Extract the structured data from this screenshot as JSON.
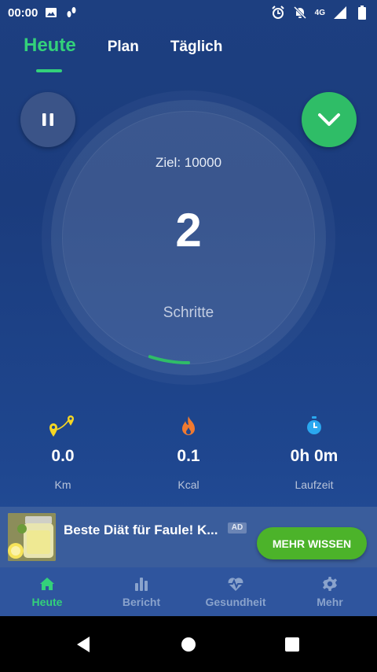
{
  "status_bar": {
    "time": "00:00",
    "network": "4G",
    "icons": [
      "image-icon",
      "footsteps-icon",
      "alarm-icon",
      "notifications-off-icon",
      "signal-icon",
      "battery-icon"
    ]
  },
  "tabs": [
    {
      "label": "Heute",
      "active": true
    },
    {
      "label": "Plan",
      "active": false
    },
    {
      "label": "Täglich",
      "active": false
    }
  ],
  "tracker": {
    "goal_label": "Ziel: 10000",
    "step_count": "2",
    "steps_label": "Schritte",
    "progress_fraction": 0.0002
  },
  "stats": [
    {
      "value": "0.0",
      "unit": "Km",
      "icon": "map-route-icon",
      "color": "#f5d623"
    },
    {
      "value": "0.1",
      "unit": "Kcal",
      "icon": "flame-icon",
      "color": "#f07a30"
    },
    {
      "value": "0h 0m",
      "unit": "Laufzeit",
      "icon": "stopwatch-icon",
      "color": "#2aa8f0"
    }
  ],
  "ad": {
    "title": "Beste Diät für Faule! K...",
    "badge": "AD",
    "cta": "MEHR WISSEN"
  },
  "bottom_nav": [
    {
      "label": "Heute",
      "icon": "home-icon",
      "active": true
    },
    {
      "label": "Bericht",
      "icon": "bar-chart-icon",
      "active": false
    },
    {
      "label": "Gesundheit",
      "icon": "heart-pulse-icon",
      "active": false
    },
    {
      "label": "Mehr",
      "icon": "gear-icon",
      "active": false
    }
  ],
  "colors": {
    "accent_green": "#33d17a",
    "background": "#1d3f80",
    "cta_green": "#4cb32a"
  }
}
